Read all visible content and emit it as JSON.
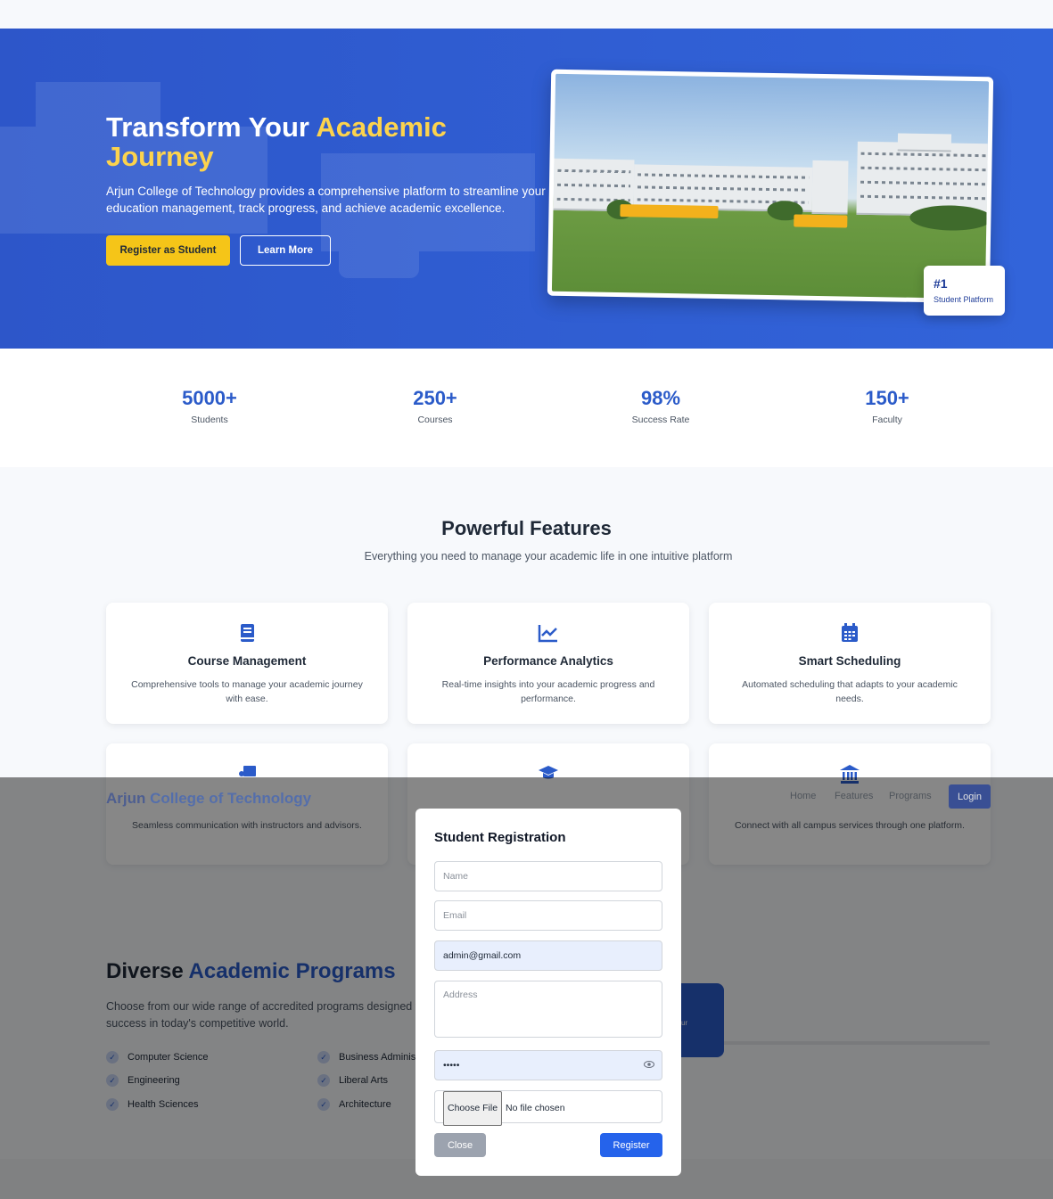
{
  "hero": {
    "title_part1": "Transform Your ",
    "title_highlight1": "Academic",
    "title_highlight2": "Journey",
    "description": "Arjun College of Technology provides a comprehensive platform to streamline your education management, track progress, and achieve academic excellence.",
    "register_button": "Register as Student",
    "learn_button": "Learn More",
    "badge_number": "#1",
    "badge_text": "Student Platform"
  },
  "stats": [
    {
      "value": "5000+",
      "label": "Students"
    },
    {
      "value": "250+",
      "label": "Courses"
    },
    {
      "value": "98%",
      "label": "Success Rate"
    },
    {
      "value": "150+",
      "label": "Faculty"
    }
  ],
  "features": {
    "title": "Powerful Features",
    "subtitle": "Everything you need to manage your academic life in one intuitive platform",
    "cards": [
      {
        "title": "Course Management",
        "desc": "Comprehensive tools to manage your academic journey with ease.",
        "icon": "book-icon"
      },
      {
        "title": "Performance Analytics",
        "desc": "Real-time insights into your academic progress and performance.",
        "icon": "chart-line-icon"
      },
      {
        "title": "Smart Scheduling",
        "desc": "Automated scheduling that adapts to your academic needs.",
        "icon": "calendar-icon"
      },
      {
        "title": "",
        "desc": "Seamless communication with instructors and advisors.",
        "icon": "chalkboard-user-icon"
      },
      {
        "title": "",
        "desc": "",
        "icon": "graduation-cap-icon"
      },
      {
        "title": "",
        "desc": "Connect with all campus services through one platform.",
        "icon": "university-icon"
      }
    ]
  },
  "programs": {
    "title_part1": "Diverse ",
    "title_highlight": "Academic Programs",
    "description": "Choose from our wide range of accredited programs designed to success in today's competitive world.",
    "items": [
      "Computer Science",
      "Business Administ",
      "Engineering",
      "Liberal Arts",
      "Health Sciences",
      "Architecture"
    ],
    "side_text": "ur"
  },
  "navbar": {
    "brand_part1": "Arjun ",
    "brand_part2": "College of Technology",
    "links": [
      "Home",
      "Features",
      "Programs"
    ],
    "login": "Login"
  },
  "modal": {
    "title": "Student Registration",
    "name_placeholder": "Name",
    "email_placeholder": "Email",
    "email2_value": "admin@gmail.com",
    "address_placeholder": "Address",
    "password_value": "•••••",
    "file_button": "Choose File",
    "file_status": "No file chosen",
    "close": "Close",
    "register": "Register"
  },
  "colors": {
    "primary": "#2b5bc9",
    "accent": "#f5c518",
    "navy": "#1f3d99"
  }
}
